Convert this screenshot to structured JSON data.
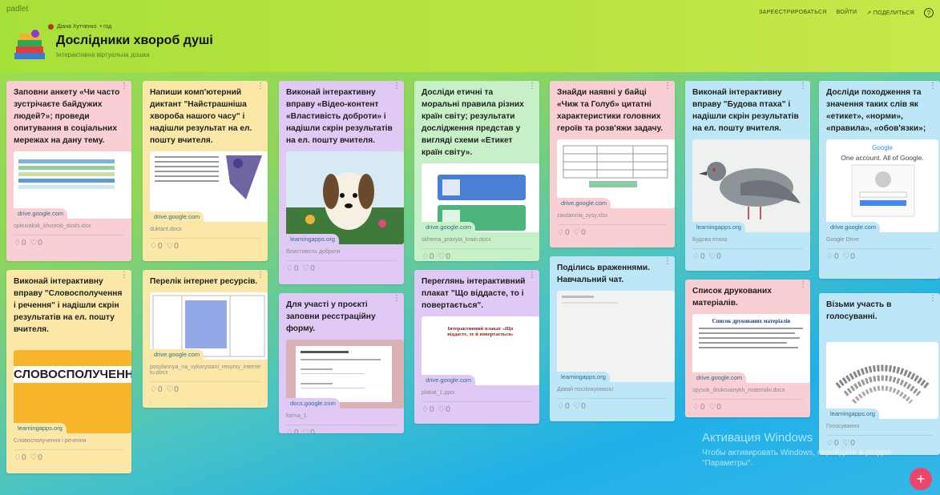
{
  "header": {
    "brand": "padlet",
    "author": "Діана Хутченко",
    "time": "• год",
    "title": "Дослідники хвороб душі",
    "subtitle": "Інтерактивна віртуальна дошка",
    "nav": {
      "signup": "ЗАРЕЄСТРИРОВАТЬСЯ",
      "login": "ВОЙТИ",
      "share": "↗ ПОДЕЛИТЬСЯ",
      "help": "?"
    }
  },
  "cards": [
    {
      "text": "Заповни анкету «Чи часто зустрічаєте байдужих людей?»; проведи опитування в соціальних мережах на дану тему.",
      "domain": "drive.google.com",
      "file": "opituvalnik_khvorob_dushi.xlsx",
      "reactions": "♢0 ♡0"
    },
    {
      "text": "Виконай інтерактивну вправу \"Словосполучення і речення\" і надішли скрін результатів на ел. пошту вчителя.",
      "domain": "learningapps.org",
      "file": "Словосполучення і речення",
      "reactions": "♢0 ♡0",
      "image_text": "СЛОВОСПОЛУЧЕННЯ"
    },
    {
      "text": "Напиши комп'ютерний диктант \"Найстрашніша хвороба нашого часу\" і надішли результат на ел. пошту вчителя.",
      "domain": "drive.google.com",
      "file": "duktant.docx",
      "reactions": "♢0 ♡0"
    },
    {
      "text": "Перелік інтернет ресурсів.",
      "domain": "drive.google.com",
      "file": "posylannya_na_vykorystani_resursy_interne tu.docx",
      "reactions": "♢0 ♡0"
    },
    {
      "text": "Виконай інтерактивну вправу «Відео-контент «Властивість доброти» і надішли скрін результатів на ел. пошту вчителя.",
      "domain": "learningapps.org",
      "file": "Властивість доброти",
      "reactions": "♢0 ♡0"
    },
    {
      "text": "Для участі у проєкті заповни ресстраційну форму.",
      "domain": "docs.google.com",
      "file": "forma_1",
      "reactions": "♢0 ♡0"
    },
    {
      "text": "Досліди етичні та моральні правила різних країн світу; результати дослідження представ у вигляді схеми «Етикет країн світу».",
      "domain": "drive.google.com",
      "file": "skhema_pravyla_krain.docx",
      "reactions": "♢0 ♡0"
    },
    {
      "text": "Переглянь інтерактивний плакат \"Що віддасте, то і повертається\".",
      "domain": "drive.google.com",
      "file": "plakat_1.pptx",
      "reactions": "♢0 ♡0",
      "image_text": "Інтерактивний плакат «Що віддасте, те й повертається»"
    },
    {
      "text": "Знайди наявні у байці «Чиж та Голуб» цитатні характеристики головних героїв та розв'яжи задачу.",
      "domain": "drive.google.com",
      "file": "zavdannia_zysy.xlsx",
      "reactions": "♢0 ♡0"
    },
    {
      "text": "Поділись враженнями. Навчальний чат.",
      "domain": "learningapps.org",
      "file": "Давай поспілкуємось!",
      "reactions": "♢0 ♡0"
    },
    {
      "text": "Виконай інтерактивну вправу \"Будова птаха\" і надішли скрін результатів на ел. пошту вчителя.",
      "domain": "learningapps.org",
      "file": "Будова птаха",
      "reactions": "♢0 ♡0"
    },
    {
      "text": "Список друкованих матеріалів.",
      "domain": "drive.google.com",
      "file": "spysok_drukovanykh_materialiv.docx",
      "reactions": "♢0 ♡0",
      "image_text": "Список друкованих матеріалів"
    },
    {
      "text": "Досліди походження та значення таких слів як «етикет», «норми», «правила», «обов'язки»;",
      "domain": "drive.google.com",
      "file": "Google Drive",
      "reactions": "♢0 ♡0",
      "image_text": "Google",
      "image_sub": "One account. All of Google."
    },
    {
      "text": "Візьми участь в голосуванні.",
      "domain": "learningapps.org",
      "file": "Голосування",
      "reactions": "♢0 ♡0"
    }
  ],
  "watermark": {
    "line1": "Активация Windows",
    "line2": "Чтобы активировать Windows, перейдите в раздел \"Параметры\"."
  },
  "fab": "+"
}
